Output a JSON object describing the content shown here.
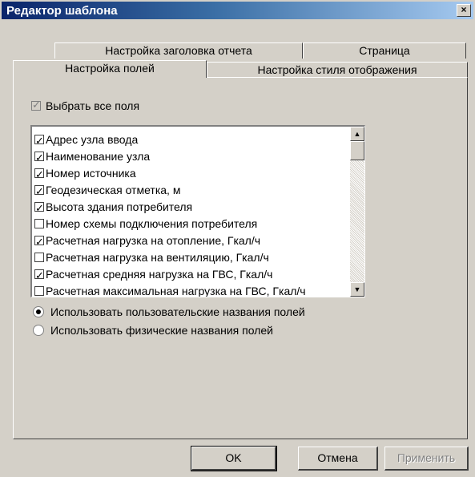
{
  "window": {
    "title": "Редактор шаблона",
    "close_symbol": "×"
  },
  "tabs": {
    "row_back": [
      {
        "label": "Настройка заголовка отчета"
      },
      {
        "label": "Страница"
      }
    ],
    "row_front": [
      {
        "label": "Настройка полей",
        "active": true
      },
      {
        "label": "Настройка стиля отображения"
      }
    ]
  },
  "fields_panel": {
    "select_all": {
      "label": "Выбрать все поля",
      "checked": true,
      "enabled": false
    },
    "list": [
      {
        "label": "Адрес узла ввода",
        "checked": true
      },
      {
        "label": "Наименование узла",
        "checked": true
      },
      {
        "label": "Номер источника",
        "checked": true
      },
      {
        "label": "Геодезическая отметка, м",
        "checked": true
      },
      {
        "label": "Высота здания потребителя",
        "checked": true
      },
      {
        "label": "Номер схемы подключения потребителя",
        "checked": false
      },
      {
        "label": "Расчетная нагрузка на отопление, Гкал/ч",
        "checked": true
      },
      {
        "label": "Расчетная нагрузка на вентиляцию, Гкал/ч",
        "checked": false
      },
      {
        "label": "Расчетная средняя нагрузка на ГВС, Гкал/ч",
        "checked": true
      },
      {
        "label": "Расчетная максимальная нагрузка на ГВС, Гкал/ч",
        "checked": false
      }
    ],
    "scroll": {
      "up_icon": "▲",
      "down_icon": "▼"
    },
    "radio_options": [
      {
        "label": "Использовать пользовательские названия  полей",
        "selected": true
      },
      {
        "label": "Использовать физические названия полей",
        "selected": false
      }
    ]
  },
  "buttons": {
    "ok": "OK",
    "cancel": "Отмена",
    "apply": "Применить"
  }
}
